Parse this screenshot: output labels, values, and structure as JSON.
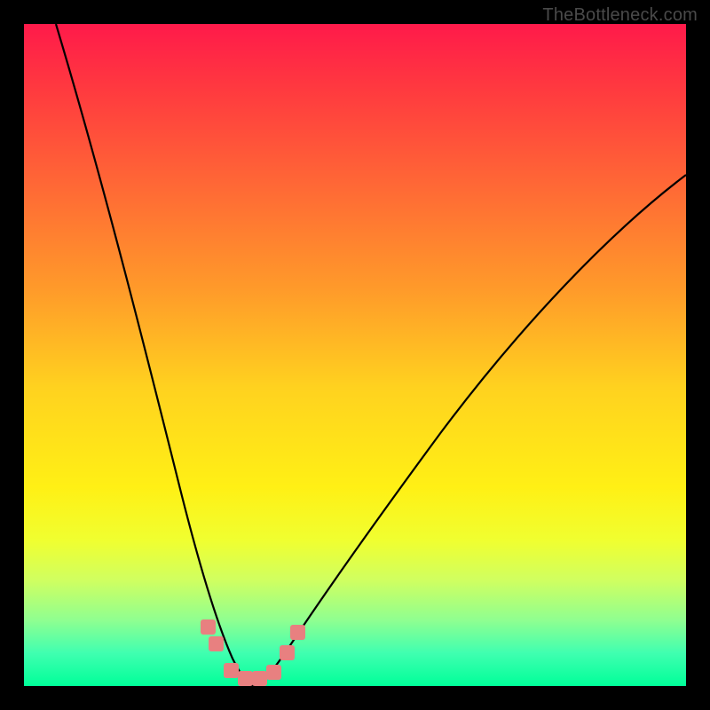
{
  "watermark": "TheBottleneck.com",
  "chart_data": {
    "type": "line",
    "title": "",
    "xlabel": "",
    "ylabel": "",
    "xlim": [
      0,
      100
    ],
    "ylim": [
      0,
      100
    ],
    "grid": false,
    "legend": false,
    "background_gradient": {
      "top": "#ff1a4a",
      "mid": "#fff015",
      "bottom": "#00ff99"
    },
    "series": [
      {
        "name": "left-curve",
        "color": "#000000",
        "x": [
          5,
          10,
          15,
          20,
          23,
          26,
          28,
          30,
          32,
          34
        ],
        "values": [
          100,
          78,
          56,
          34,
          21,
          11,
          6,
          3,
          1,
          0
        ]
      },
      {
        "name": "right-curve",
        "color": "#000000",
        "x": [
          34,
          36,
          38,
          42,
          48,
          56,
          66,
          78,
          90,
          100
        ],
        "values": [
          0,
          1,
          3,
          8,
          17,
          29,
          43,
          57,
          69,
          78
        ]
      },
      {
        "name": "valley-markers",
        "color": "#e88080",
        "marker": "square",
        "x": [
          27.5,
          28.5,
          31.0,
          33.0,
          35.0,
          37.0,
          39.0,
          40.5
        ],
        "values": [
          8.5,
          6.0,
          2.0,
          1.0,
          1.0,
          2.0,
          5.0,
          8.0
        ]
      }
    ]
  }
}
